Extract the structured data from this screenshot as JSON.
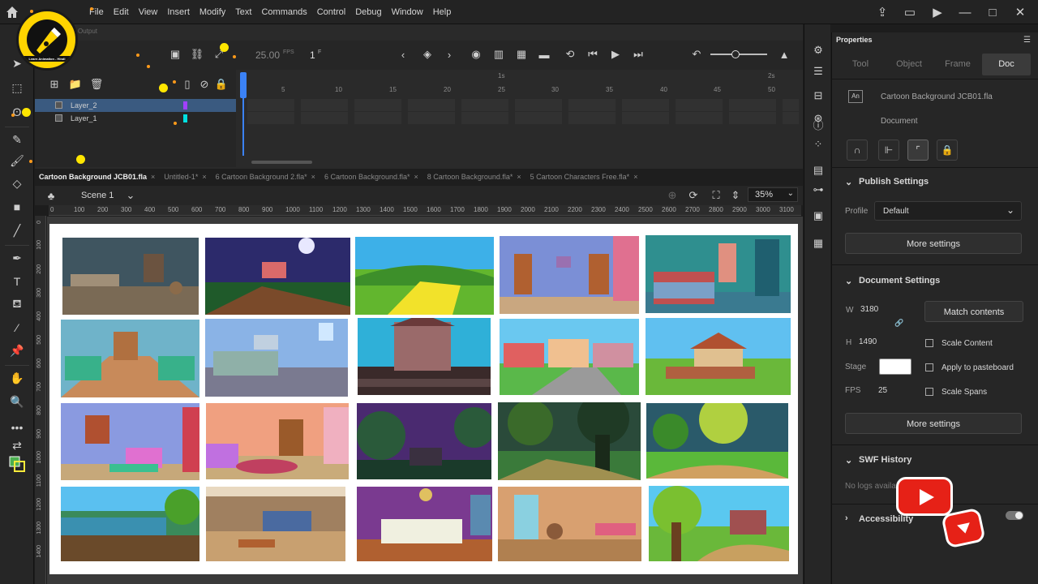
{
  "menu": [
    "File",
    "Edit",
    "View",
    "Insert",
    "Modify",
    "Text",
    "Commands",
    "Control",
    "Debug",
    "Window",
    "Help"
  ],
  "logo_text": "Learn Animation - Hindi",
  "timeline": {
    "output_tab": "Output",
    "fps": "25.00",
    "fps_unit": "FPS",
    "frame": "1",
    "frame_unit": "F",
    "layers": [
      {
        "name": "Layer_2",
        "color": "#a040ff",
        "selected": true
      },
      {
        "name": "Layer_1",
        "color": "#00e0e0",
        "selected": false
      }
    ],
    "frame_numbers": [
      "5",
      "10",
      "15",
      "20",
      "25",
      "30",
      "35",
      "40",
      "45",
      "50"
    ],
    "seconds": [
      "1s",
      "2s"
    ]
  },
  "doc_tabs": [
    {
      "label": "Cartoon Background JCB01.fla",
      "active": true
    },
    {
      "label": "Untitled-1*",
      "active": false
    },
    {
      "label": "6 Cartoon Background 2.fla*",
      "active": false
    },
    {
      "label": "6 Cartoon Background.fla*",
      "active": false
    },
    {
      "label": "8 Cartoon Background.fla*",
      "active": false
    },
    {
      "label": "5 Cartoon Characters Free.fla*",
      "active": false
    }
  ],
  "scene": {
    "label": "Scene 1",
    "zoom": "35%"
  },
  "hruler": [
    "0",
    "100",
    "200",
    "300",
    "400",
    "500",
    "600",
    "700",
    "800",
    "900",
    "1000",
    "1100",
    "1200",
    "1300",
    "1400",
    "1500",
    "1600",
    "1700",
    "1800",
    "1900",
    "2000",
    "2100",
    "2200",
    "2300",
    "2400",
    "2500",
    "2600",
    "2700",
    "2800",
    "2900",
    "3000",
    "3100"
  ],
  "vruler": [
    "0",
    "100",
    "200",
    "300",
    "400",
    "500",
    "600",
    "700",
    "800",
    "900",
    "1000",
    "1100",
    "1200",
    "1300",
    "1400"
  ],
  "properties": {
    "title": "Properties",
    "tabs": [
      "Tool",
      "Object",
      "Frame",
      "Doc"
    ],
    "active_tab": "Doc",
    "doc_name": "Cartoon Background JCB01.fla",
    "doc_type": "Document",
    "doc_icon": "An",
    "publish_settings": "Publish Settings",
    "profile_label": "Profile",
    "profile_value": "Default",
    "more_settings": "More settings",
    "document_settings": "Document Settings",
    "w_label": "W",
    "w_value": "3180",
    "h_label": "H",
    "h_value": "1490",
    "match_contents": "Match contents",
    "scale_content": "Scale Content",
    "stage_label": "Stage",
    "stage_color": "#ffffff",
    "apply_pasteboard": "Apply to pasteboard",
    "fps_label": "FPS",
    "fps_value": "25",
    "scale_spans": "Scale Spans",
    "more_settings_2": "More settings",
    "swf_history": "SWF History",
    "no_logs": "No logs availa",
    "accessibility": "Accessibility"
  }
}
